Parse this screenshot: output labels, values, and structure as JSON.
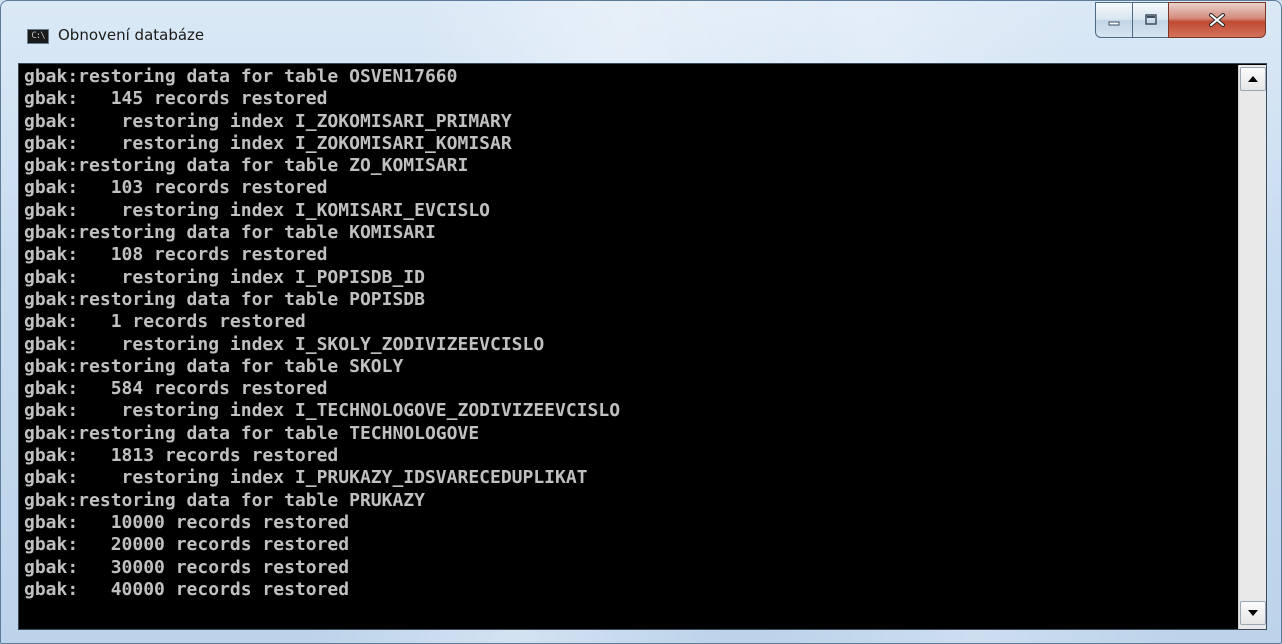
{
  "window": {
    "title": "Obnovení databáze",
    "icon_text": "C:\\",
    "icon": "console-app-icon"
  },
  "caption_buttons": [
    {
      "name": "minimize",
      "icon": "minimize-icon"
    },
    {
      "name": "maximize",
      "icon": "maximize-icon"
    },
    {
      "name": "close",
      "icon": "close-icon"
    }
  ],
  "colors": {
    "console_background": "#000000",
    "console_text": "#c0c0c0",
    "close_button": "#c04a31"
  },
  "console": {
    "lines": [
      "gbak:restoring data for table OSVEN17660",
      "gbak:   145 records restored",
      "gbak:    restoring index I_ZOKOMISARI_PRIMARY",
      "gbak:    restoring index I_ZOKOMISARI_KOMISAR",
      "gbak:restoring data for table ZO_KOMISARI",
      "gbak:   103 records restored",
      "gbak:    restoring index I_KOMISARI_EVCISLO",
      "gbak:restoring data for table KOMISARI",
      "gbak:   108 records restored",
      "gbak:    restoring index I_POPISDB_ID",
      "gbak:restoring data for table POPISDB",
      "gbak:   1 records restored",
      "gbak:    restoring index I_SKOLY_ZODIVIZEEVCISLO",
      "gbak:restoring data for table SKOLY",
      "gbak:   584 records restored",
      "gbak:    restoring index I_TECHNOLOGOVE_ZODIVIZEEVCISLO",
      "gbak:restoring data for table TECHNOLOGOVE",
      "gbak:   1813 records restored",
      "gbak:    restoring index I_PRUKAZY_IDSVARECEDUPLIKAT",
      "gbak:restoring data for table PRUKAZY",
      "gbak:   10000 records restored",
      "gbak:   20000 records restored",
      "gbak:   30000 records restored",
      "gbak:   40000 records restored"
    ]
  }
}
